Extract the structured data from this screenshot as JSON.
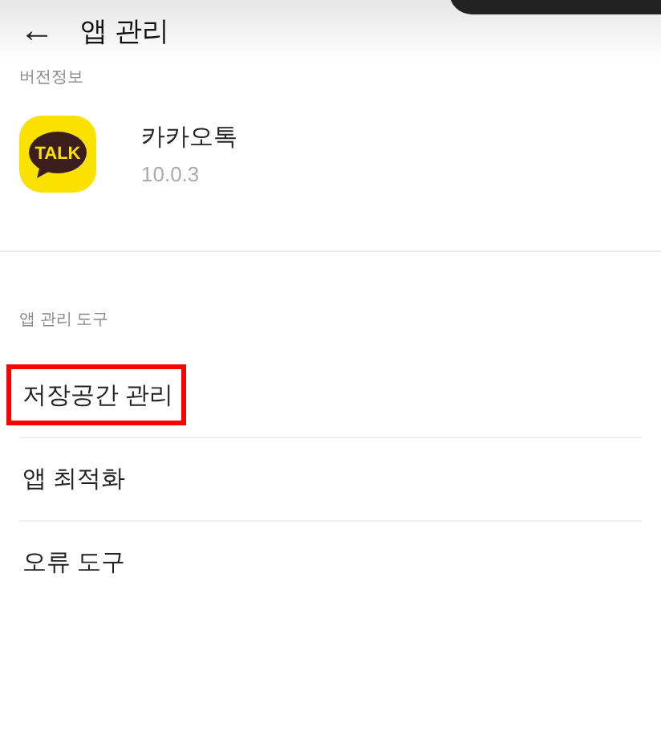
{
  "header": {
    "back_icon": "←",
    "title": "앱 관리"
  },
  "version_section": {
    "label": "버전정보",
    "app": {
      "logo_text": "TALK",
      "name": "카카오톡",
      "version": "10.0.3"
    }
  },
  "tools_section": {
    "label": "앱 관리 도구",
    "items": [
      {
        "label": "저장공간 관리",
        "highlighted": true
      },
      {
        "label": "앱 최적화",
        "highlighted": false
      },
      {
        "label": "오류 도구",
        "highlighted": false
      }
    ]
  }
}
